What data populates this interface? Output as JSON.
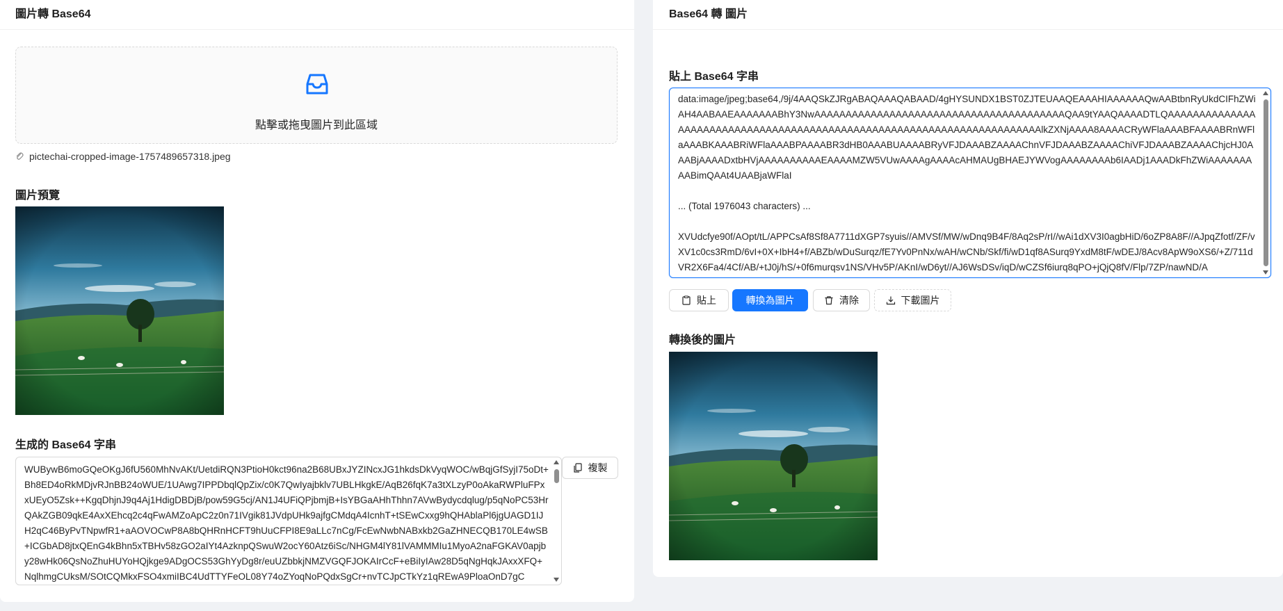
{
  "left_card": {
    "title": "圖片轉 Base64",
    "upload_hint": "點擊或拖曳圖片到此區域",
    "file_name": "pictechai-cropped-image-1757489657318.jpeg",
    "preview_label": "圖片預覽",
    "output_label": "生成的 Base64 字串",
    "output_text": "WUBywB6moGQeOKgJ6fU560MhNvAKt/UetdiRQN3PtioH0kct96na2B68UBxJYZINcxJG1hkdsDkVyqWOC/wBqjGfSyjI75oDt+Bh8ED4oRkMDjvRJnBB24oWUE/1UAwg7IPPDbqlQpZix/c0K7QwIyajbklv7UBLHkgkE/AqB26fqK7a3tXLzyP0oAkaRWPluFPxxUEyO5Zsk++KgqDhjnJ9q4Aj1HdigDBDjB/pow59G5cj/AN1J4UFiQPjbmjB+IsYBGaAHhThhn7AVwBydycdqlug/p5qNoPC53HrQAkZGB09qkE4AxXEhcq2c4qFwAMZoApC2z0n71IVgik81JVdpUHk9ajfgCMdqA4IcnhT+tSEwCxxg9hQHAblaPl6jgUAGD1IJH2qC46ByPvTNpwfR1+aAOVOCwP8A8bQHRnHCFT9hUuCFPI8E9aLLc7nCg/FcEwNwbNABxkb2GaZHNECQB170LE4wSB+ICGbAD8jtxQEnG4kBhn5xTBHv58zGO2aIYt4AzknpQSwuW2ocY60Atz6iSc/NHGM4lY81lVAMMMIu1MyoA2naFGKAV0apjby28wHk06QsNoZhuHUYoHQjkge9ADgOCS53GhYyDg8r/euUZbbkjNMZVGQFJOKAIrCcF+eBiIyIAw28D5qNgHqkJAxxXFQ+NqlhmgCUksM/SOtCQMkxFSO4xmiIBC4UdTTYFeOL08Y74oZYoqNoPQdxSgCr+nvTCJpCTkYz1qREwA9PloaOnD7gC"
  },
  "right_card": {
    "title": "Base64 轉 圖片",
    "input_label": "貼上 Base64 字串",
    "input_text": "data:image/jpeg;base64,/9j/4AAQSkZJRgABAQAAAQABAAD/4gHYSUNDX1BST0ZJTEUAAQEAAAHIAAAAAAQwAABtbnRyUkdCIFhZWiAH4AABAAEAAAAAAABhY3NwAAAAAAAAAAAAAAAAAAAAAAAAAAAAAAAAAAAAAAAAQAA9tYAAQAAAADTLQAAAAAAAAAAAAAAAAAAAAAAAAAAAAAAAAAAAAAAAAAAAAAAAAAAAAAAAAAAAAAAAAAAAAAAAAlkZXNjAAAA8AAAACRyWFlaAAABFAAAABRnWFlaAAABKAAABRiWFlaAAABPAAAABR3dHB0AAABUAAAABRyVFJDAAABZAAAAChnVFJDAAABZAAAAChiVFJDAAABZAAAAChjcHJ0AAABjAAAADxtbHVjAAAAAAAAAAEAAAAMZW5VUwAAAAgAAAAcAHMAUgBHAEJYWVogAAAAAAAAb6IAADj1AAADkFhZWiAAAAAAAAABimQAAt4UAABjaWFlaI\n\n... (Total 1976043 characters) ...\n\nXVUdcfye90f/AOpt/tL/APPCsAf8Sf8A7711dXGP7syuis//AMVSf/MW/wDnq9B4F/8Aq2sP/rI//wAi1dXV3I0agbHiD/6oZP8A8F//AJpqZfotf/ZF/vXV1c0cs3RmD/6vI+0X+IbH4+f/ABZb/wDuSurqz/fE7Yv0PnNx/wAH/wCNb/Skf/fi/wD1qf8ASurq9YxdM8tF/wDEJ/8Acv8ApW9oXS6/+Z/711dVR2X6Fa4/4Cf/AB/+tJ0j/hS/+0f6murqsv1NS/VHv5P/AKnI/wD6yt//AJ6WsDSv/iqD/wCZSf6iurq8qPO+jQjQ8fV/Flp/7ZP/nawND/A",
    "buttons": {
      "paste": "貼上",
      "convert": "轉換為圖片",
      "clear": "清除",
      "download": "下載圖片"
    },
    "result_label": "轉換後的圖片"
  },
  "copy_button": "複製",
  "colors": {
    "accent": "#1677ff",
    "background": "#f0f2f5"
  }
}
